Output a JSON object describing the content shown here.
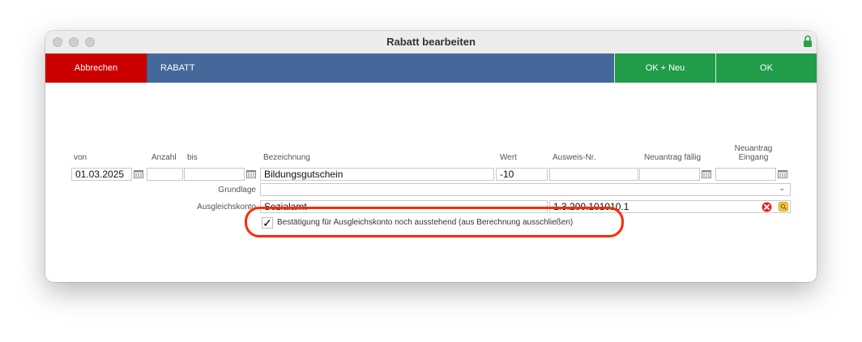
{
  "window": {
    "title": "Rabatt bearbeiten"
  },
  "toolbar": {
    "cancel_label": "Abbrechen",
    "section_label": "RABATT",
    "ok_new_label": "OK + Neu",
    "ok_label": "OK"
  },
  "columns": {
    "von": "von",
    "anzahl": "Anzahl",
    "bis": "bis",
    "bezeichnung": "Bezeichnung",
    "wert": "Wert",
    "ausweis": "Ausweis-Nr.",
    "faellig": "Neuantrag fällig",
    "eingang_line1": "Neuantrag",
    "eingang_line2": "Eingang"
  },
  "row": {
    "von": "01.03.2025",
    "anzahl": "",
    "bis": "",
    "bezeichnung": "Bildungsgutschein",
    "wert": "-10",
    "ausweis": "",
    "faellig": "",
    "eingang": ""
  },
  "grundlage": {
    "label": "Grundlage",
    "value": ""
  },
  "ausgleichskonto": {
    "label": "Ausgleichskonto",
    "name": "Sozialamt",
    "number": "1.3.200.101010.1"
  },
  "confirmation": {
    "checked_mark": "✓",
    "label": "Bestätigung für Ausgleichskonto noch ausstehend (aus Berechnung ausschließen)"
  },
  "colors": {
    "cancel": "#cc0000",
    "header": "#44689a",
    "ok": "#219c48",
    "highlight": "#ff2a00"
  },
  "icons": {
    "lock": "lock-icon",
    "calendar": "calendar-icon",
    "dropdown": "chevron-down-icon",
    "clear": "clear-icon",
    "lookup": "lookup-icon"
  }
}
